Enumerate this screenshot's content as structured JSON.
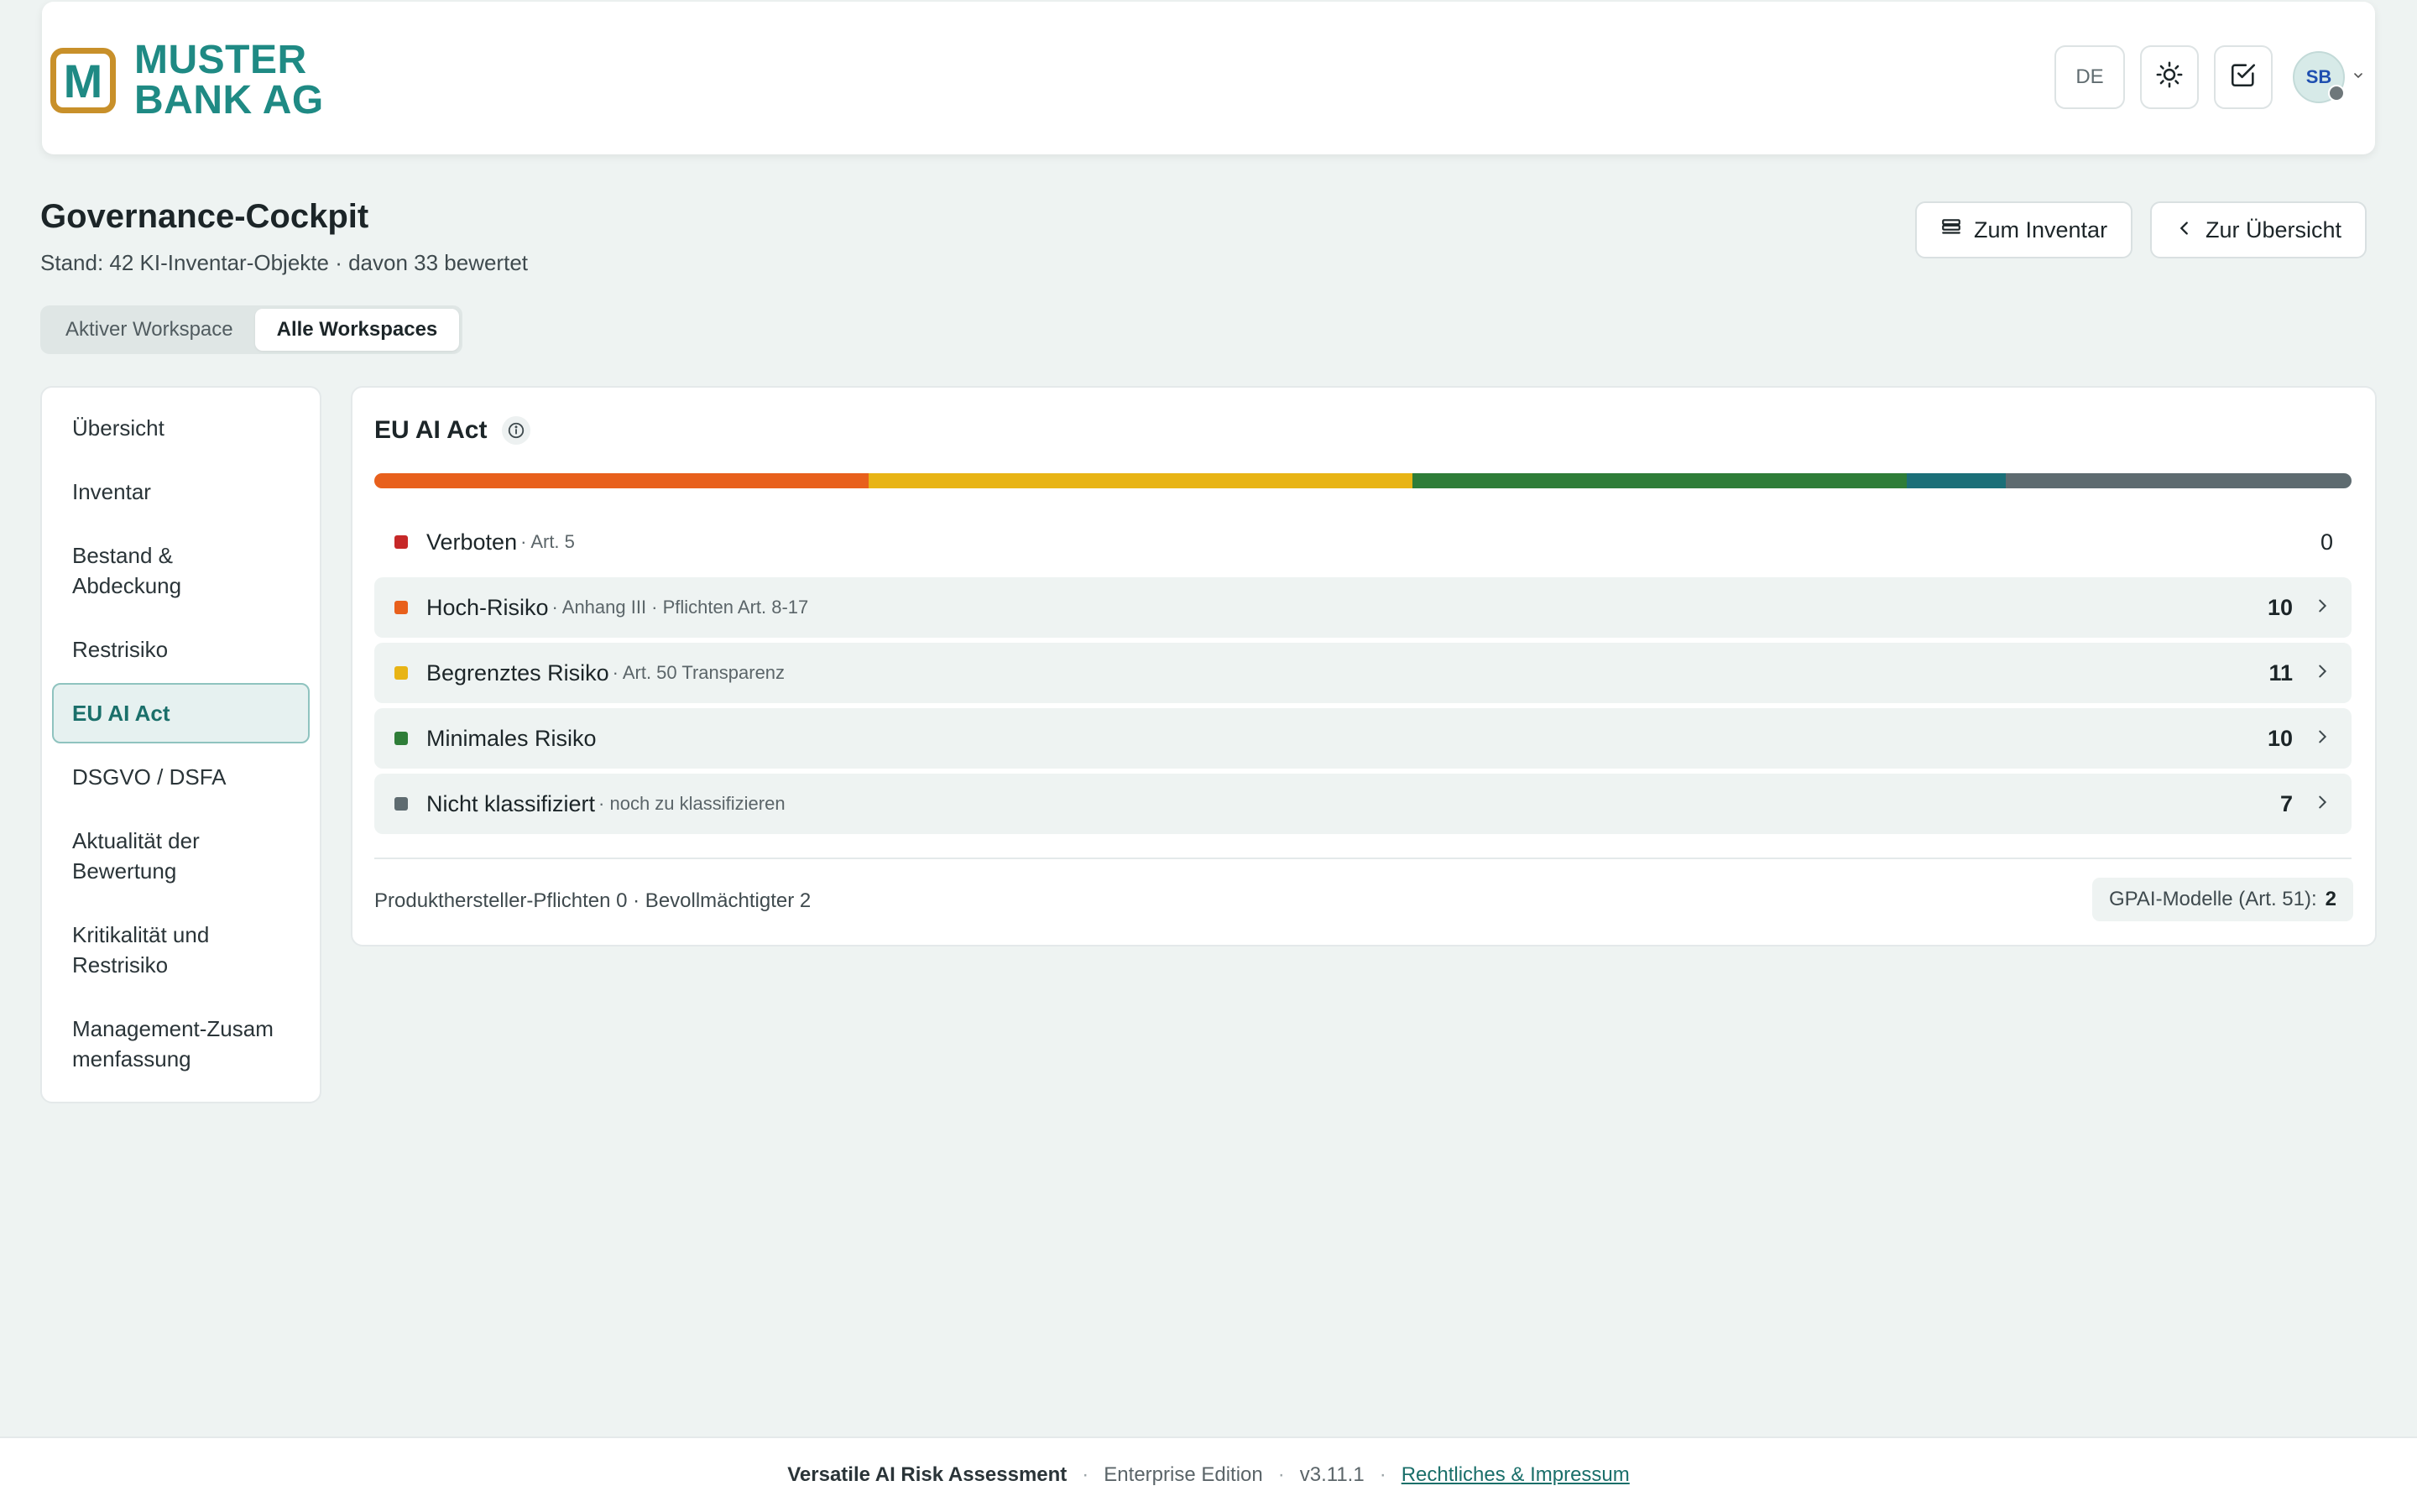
{
  "brand": {
    "logo_letter": "M",
    "name_line1": "MUSTER",
    "name_line2": "BANK AG",
    "primary_color": "#1f8a84",
    "accent_color": "#c8902a"
  },
  "topbar": {
    "language": "DE",
    "theme_icon": "sun-icon",
    "tasks_icon": "checkbox-icon",
    "user_initials": "SB"
  },
  "header": {
    "title": "Governance-Cockpit",
    "subtitle": "Stand: 42 KI-Inventar-Objekte · davon 33 bewertet",
    "btn_inventory": "Zum Inventar",
    "btn_overview": "Zur Übersicht"
  },
  "workspace_toggle": {
    "options": [
      "Aktiver Workspace",
      "Alle Workspaces"
    ],
    "selected": "Alle Workspaces"
  },
  "sidebar": {
    "items": [
      {
        "label": "Übersicht"
      },
      {
        "label": "Inventar"
      },
      {
        "label": "Bestand & Abdeckung"
      },
      {
        "label": "Restrisiko"
      },
      {
        "label": "EU AI Act"
      },
      {
        "label": "DSGVO / DSFA"
      },
      {
        "label": "Aktualität der Bewertung"
      },
      {
        "label": "Kritikalität und Restrisiko"
      },
      {
        "label": "Management-Zusammenfassung"
      }
    ],
    "active": "EU AI Act"
  },
  "card": {
    "title": "EU AI Act",
    "distribution": [
      {
        "key": "hoch",
        "value": 10,
        "color": "#e8601c"
      },
      {
        "key": "begrenzt",
        "value": 11,
        "color": "#e8b415"
      },
      {
        "key": "minimal",
        "value": 10,
        "color": "#2e7d38"
      },
      {
        "key": "teal",
        "value": 2,
        "color": "#1b6f78"
      },
      {
        "key": "nicht",
        "value": 7,
        "color": "#5e6b70"
      }
    ],
    "rows": [
      {
        "label": "Verboten",
        "sub": "· Art. 5",
        "count": "0",
        "color": "#c62828"
      },
      {
        "label": "Hoch-Risiko",
        "sub": "· Anhang III · Pflichten Art. 8-17",
        "count": "10",
        "color": "#e8601c"
      },
      {
        "label": "Begrenztes Risiko",
        "sub": "· Art. 50 Transparenz",
        "count": "11",
        "color": "#e8b415"
      },
      {
        "label": "Minimales Risiko",
        "sub": "",
        "count": "10",
        "color": "#2e7d38"
      },
      {
        "label": "Nicht klassifiziert",
        "sub": "· noch zu klassifizieren",
        "count": "7",
        "color": "#5e6b70"
      }
    ],
    "footer_note": "Produkthersteller-Pflichten 0 · Bevollmächtigter 2",
    "gpai_label": "GPAI-Modelle (Art. 51):",
    "gpai_value": "2"
  },
  "footer": {
    "product": "Versatile AI Risk Assessment",
    "edition": "Enterprise Edition",
    "version": "v3.11.1",
    "legal_link": "Rechtliches & Impressum",
    "sep": "·"
  }
}
